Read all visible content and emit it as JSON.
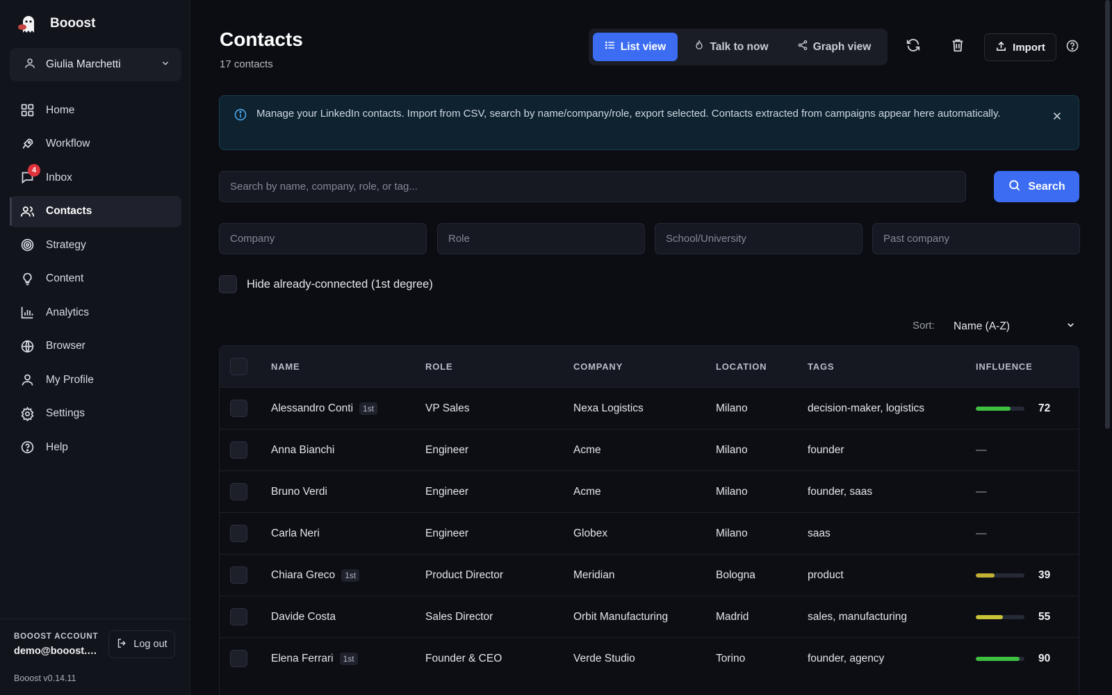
{
  "app": {
    "name": "Booost"
  },
  "user": {
    "name": "Giulia Marchetti"
  },
  "nav": [
    {
      "label": "Home",
      "icon": "home-grid-icon"
    },
    {
      "label": "Workflow",
      "icon": "rocket-icon"
    },
    {
      "label": "Inbox",
      "icon": "chat-bubble-icon",
      "badge": "4"
    },
    {
      "label": "Contacts",
      "icon": "users-icon",
      "active": true
    },
    {
      "label": "Strategy",
      "icon": "target-icon"
    },
    {
      "label": "Content",
      "icon": "lightbulb-icon"
    },
    {
      "label": "Analytics",
      "icon": "bar-chart-icon"
    },
    {
      "label": "Browser",
      "icon": "globe-icon"
    },
    {
      "label": "My Profile",
      "icon": "user-icon"
    },
    {
      "label": "Settings",
      "icon": "gear-icon"
    },
    {
      "label": "Help",
      "icon": "help-circle-icon"
    }
  ],
  "account": {
    "label": "BOOOST ACCOUNT",
    "email": "demo@booost.n...",
    "logout": "Log out",
    "version": "Booost v0.14.11"
  },
  "page": {
    "title": "Contacts",
    "subtitle": "17 contacts"
  },
  "views": {
    "list": "List view",
    "talk": "Talk to now",
    "graph": "Graph view",
    "active": "list"
  },
  "toolbar": {
    "import": "Import"
  },
  "banner": {
    "text": "Manage your LinkedIn contacts. Import from CSV, search by name/company/role, export selected. Contacts extracted from campaigns appear here automatically."
  },
  "search": {
    "placeholder": "Search by name, company, role, or tag...",
    "button": "Search"
  },
  "filters": {
    "company": "Company",
    "role": "Role",
    "school": "School/University",
    "past_company": "Past company"
  },
  "hide_connected": {
    "label": "Hide already-connected (1st degree)",
    "checked": false
  },
  "sort": {
    "label": "Sort:",
    "value": "Name (A-Z)"
  },
  "table": {
    "columns": [
      "NAME",
      "ROLE",
      "COMPANY",
      "LOCATION",
      "TAGS",
      "INFLUENCE"
    ],
    "rows": [
      {
        "name": "Alessandro Conti",
        "degree": "1st",
        "role": "VP Sales",
        "company": "Nexa Logistics",
        "location": "Milano",
        "tags": "decision-maker, logistics",
        "influence": 72
      },
      {
        "name": "Anna Bianchi",
        "degree": "",
        "role": "Engineer",
        "company": "Acme",
        "location": "Milano",
        "tags": "founder",
        "influence": null
      },
      {
        "name": "Bruno Verdi",
        "degree": "",
        "role": "Engineer",
        "company": "Acme",
        "location": "Milano",
        "tags": "founder, saas",
        "influence": null
      },
      {
        "name": "Carla Neri",
        "degree": "",
        "role": "Engineer",
        "company": "Globex",
        "location": "Milano",
        "tags": "saas",
        "influence": null
      },
      {
        "name": "Chiara Greco",
        "degree": "1st",
        "role": "Product Director",
        "company": "Meridian",
        "location": "Bologna",
        "tags": "product",
        "influence": 39
      },
      {
        "name": "Davide Costa",
        "degree": "",
        "role": "Sales Director",
        "company": "Orbit Manufacturing",
        "location": "Madrid",
        "tags": "sales, manufacturing",
        "influence": 55
      },
      {
        "name": "Elena Ferrari",
        "degree": "1st",
        "role": "Founder & CEO",
        "company": "Verde Studio",
        "location": "Torino",
        "tags": "founder, agency",
        "influence": 90
      }
    ],
    "empty_influence": "—"
  },
  "colors": {
    "accent": "#3b6cf2",
    "influence_high": "#3fbf3f",
    "influence_mid": "#c8c236",
    "influence_low": "#c2b035",
    "badge": "#e0323a"
  }
}
